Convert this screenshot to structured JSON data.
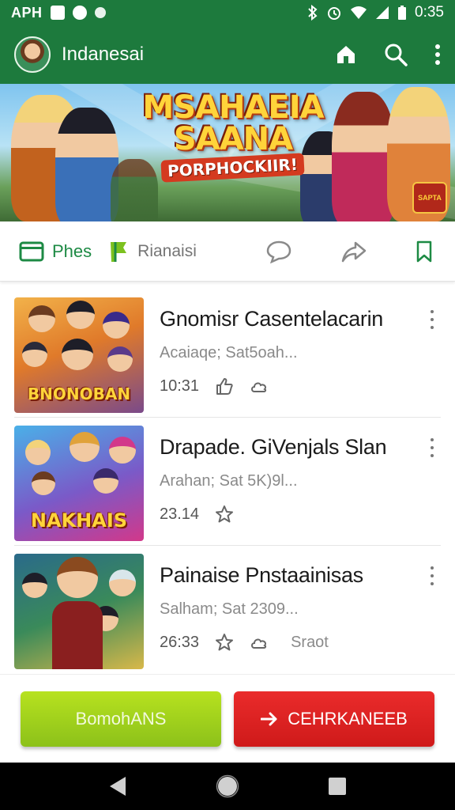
{
  "status_bar": {
    "carrier": "APH",
    "time": "0:35",
    "left_icons": [
      "qr-icon",
      "location-icon",
      "sync-icon"
    ],
    "right_icons": [
      "bluetooth-icon",
      "alarm-icon",
      "wifi-icon",
      "signal-icon",
      "battery-icon"
    ]
  },
  "app_bar": {
    "title": "Indanesai",
    "actions": [
      "home-icon",
      "search-icon",
      "more-vert-icon"
    ]
  },
  "banner": {
    "title_line1": "MSAHAEIA",
    "title_line2": "SAANA",
    "subtitle": "PORPHOCKIIR!",
    "badge": "SAPTA"
  },
  "tabs": [
    {
      "label": "Phes",
      "icon": "tablet-icon",
      "active": true
    },
    {
      "label": "Rianaisi",
      "icon": "flag-icon",
      "active": false
    }
  ],
  "tab_icons": [
    "chat-bubble-icon",
    "share-icon",
    "bookmark-icon"
  ],
  "list": [
    {
      "title": "Gnomisr Casentelacarin",
      "subtitle": "Acaiaqe; Sat5oah...",
      "time": "10:31",
      "thumb_label": "BNONOBAN",
      "actions": [
        "thumbs-up-icon",
        "cloud-icon"
      ],
      "extra": ""
    },
    {
      "title": "Drapade. GiVenjals Slan",
      "subtitle": "Arahan; Sat 5K)9l...",
      "time": "23.14",
      "thumb_label": "NAKHAIS",
      "actions": [
        "star-icon"
      ],
      "extra": ""
    },
    {
      "title": "Painaise Pnstaainisas",
      "subtitle": "Salham; Sat 2309...",
      "time": "26:33",
      "thumb_label": "",
      "actions": [
        "star-icon",
        "cloud-icon"
      ],
      "extra": "Sraot"
    }
  ],
  "buttons": {
    "primary": "BomohANS",
    "secondary": "CEHRKANEEB"
  },
  "nav": [
    "back-icon",
    "home-circle-icon",
    "recents-icon"
  ],
  "colors": {
    "primary": "#1d7a3d",
    "accent_green": "#1d8a44",
    "button_lime": "#9ccf1c",
    "button_red": "#e02424"
  }
}
